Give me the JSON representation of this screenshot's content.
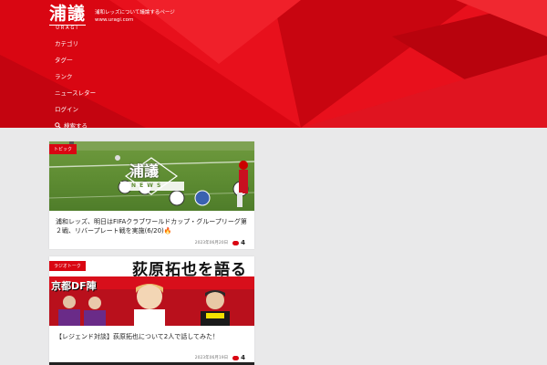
{
  "header": {
    "logo_kanji": "浦議",
    "logo_sub": "URAGI",
    "tagline_line1": "浦和レッズについて議論するページ",
    "tagline_line2": "www.uragi.com",
    "nav": [
      {
        "label": "カテゴリ"
      },
      {
        "label": "タグ一"
      },
      {
        "label": "ランク"
      },
      {
        "label": "ニュースレター"
      },
      {
        "label": "ログイン"
      },
      {
        "label": "検索する",
        "icon": "search-icon"
      }
    ],
    "colors": {
      "brand": "#d90612",
      "accent": "#ff1a1a"
    }
  },
  "posts": [
    {
      "badge": "トピック",
      "thumb_logo": "浦議",
      "thumb_news": "N E W S",
      "title": "浦和レッズ、明日はFIFAクラブワールドカップ・グループリーグ第２戦、リバープレート戦を実施(6/20)🔥",
      "date": "2023年06月20日",
      "comments": "4"
    },
    {
      "badge": "ラジオトーク",
      "banner_title": "荻原拓也を語る",
      "banner_sub": "京都DF陣",
      "title": "【レジェンド対談】荻原拓也について2人で話してみた！",
      "date": "2023年06月19日",
      "comments": "4"
    }
  ]
}
